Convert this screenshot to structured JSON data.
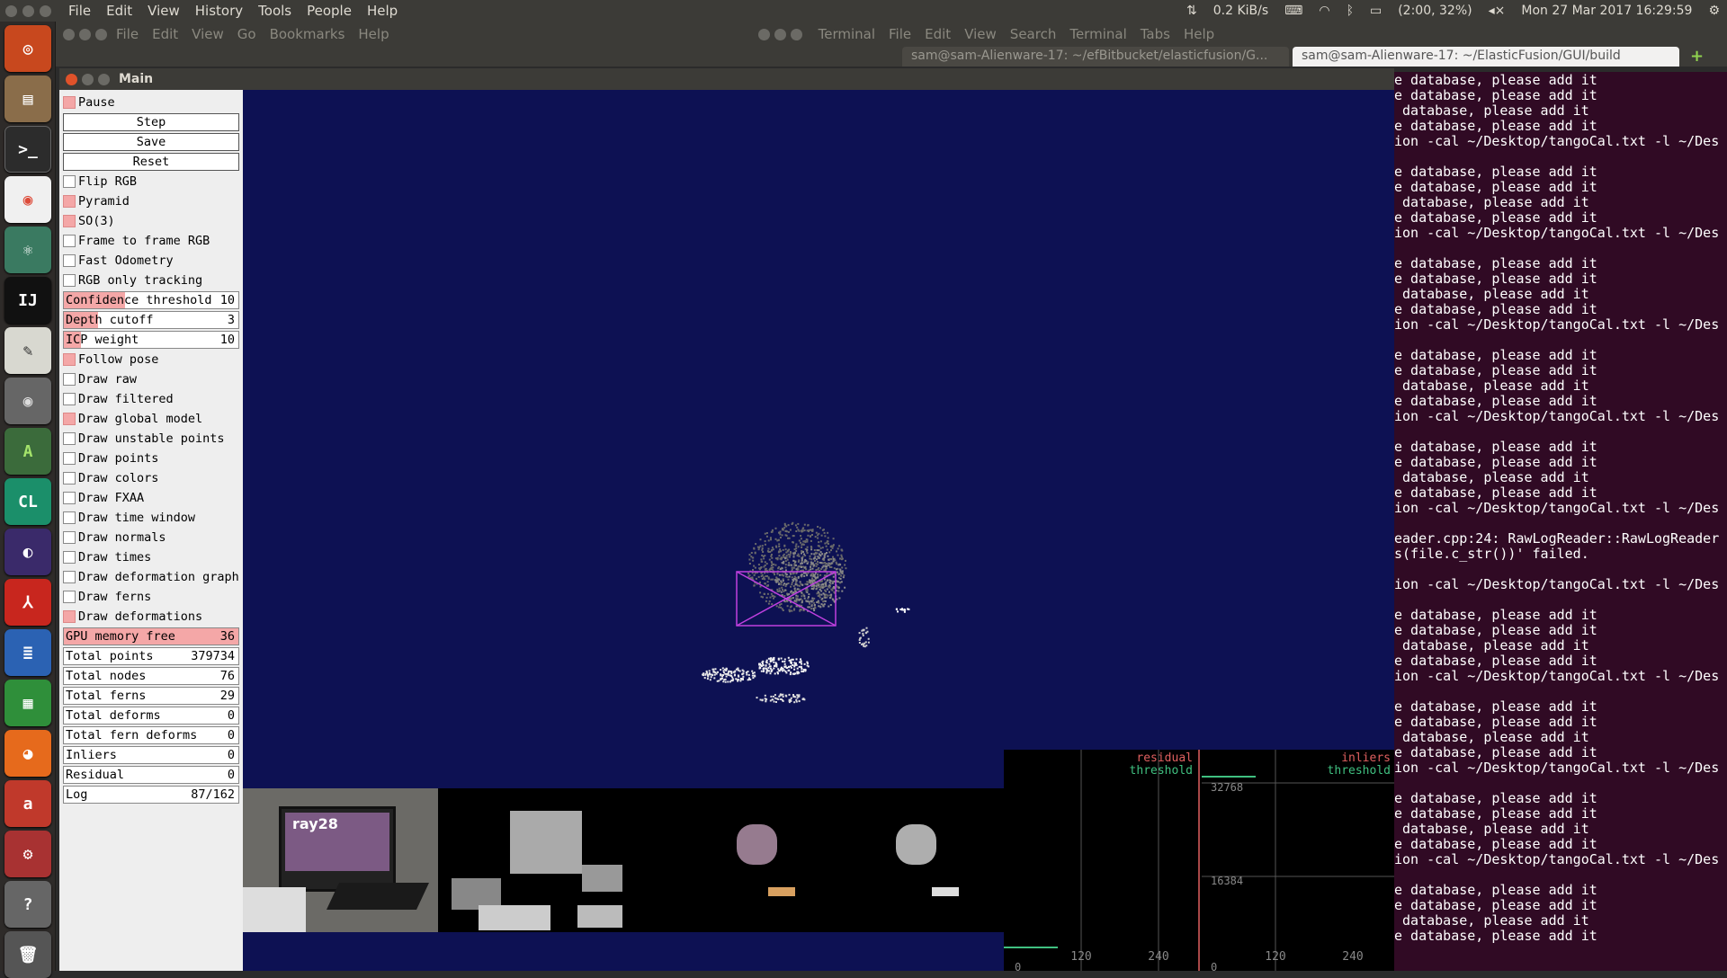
{
  "topbar": {
    "menu": [
      "File",
      "Edit",
      "View",
      "History",
      "Tools",
      "People",
      "Help"
    ],
    "net": "0.2 KiB/s",
    "battery": "(2:00, 32%)",
    "clock": "Mon 27 Mar 2017 16:29:59"
  },
  "bgwindow": {
    "menu": [
      "File",
      "Edit",
      "View",
      "Go",
      "Bookmarks",
      "Help"
    ],
    "terminal_menu": [
      "Terminal",
      "File",
      "Edit",
      "View",
      "Search",
      "Terminal",
      "Tabs",
      "Help"
    ],
    "tab1": "sam@sam-Alienware-17: ~/efBitbucket/elasticfusion/G...",
    "tab2": "sam@sam-Alienware-17: ~/ElasticFusion/GUI/build"
  },
  "launcher": [
    "ubuntu",
    "files",
    "terminal",
    "chrome",
    "atom",
    "intellij",
    "text-editor",
    "eye",
    "android-studio",
    "clion",
    "eclipse",
    "acrobat",
    "writer",
    "calc",
    "firefox",
    "amazon",
    "settings",
    "help",
    "trash"
  ],
  "main": {
    "title": "Main"
  },
  "panel": {
    "pause": "Pause",
    "step": "Step",
    "save": "Save",
    "reset": "Reset",
    "flip_rgb": "Flip RGB",
    "pyramid": "Pyramid",
    "so3": "SO(3)",
    "f2f": "Frame to frame RGB",
    "fast_odo": "Fast Odometry",
    "rgb_only": "RGB only tracking",
    "conf_label": "Confidence threshold",
    "conf_val": "10",
    "depth_label": "Depth cutoff",
    "depth_val": "3",
    "icp_label": "ICP weight",
    "icp_val": "10",
    "follow": "Follow pose",
    "draw_raw": "Draw raw",
    "draw_filtered": "Draw filtered",
    "draw_global": "Draw global model",
    "draw_unstable": "Draw unstable points",
    "draw_points": "Draw points",
    "draw_colors": "Draw colors",
    "draw_fxaa": "Draw FXAA",
    "draw_time": "Draw time window",
    "draw_normals": "Draw normals",
    "draw_times": "Draw times",
    "draw_deform_graph": "Draw deformation graph",
    "draw_ferns": "Draw ferns",
    "draw_deforms": "Draw deformations",
    "gpu_label": "GPU memory free",
    "gpu_val": "36",
    "tp_label": "Total points",
    "tp_val": "379734",
    "tn_label": "Total nodes",
    "tn_val": "76",
    "tf_label": "Total ferns",
    "tf_val": "29",
    "td_label": "Total deforms",
    "td_val": "0",
    "tfd_label": "Total fern deforms",
    "tfd_val": "0",
    "inl_label": "Inliers",
    "inl_val": "0",
    "res_label": "Residual",
    "res_val": "0",
    "log_label": "Log",
    "log_val": "87/162"
  },
  "thumb1_text": "ray28",
  "plots": {
    "res_title": "residual",
    "res_thr": "threshold",
    "inl_title": "inliers",
    "inl_thr": "threshold",
    "y1": "32768",
    "y2": "16384",
    "x": [
      "120",
      "240",
      "120",
      "240"
    ],
    "zero": "0"
  },
  "terminal_lines": [
    "e database, please add it",
    "e database, please add it",
    " database, please add it",
    "e database, please add it",
    "ion -cal ~/Desktop/tangoCal.txt -l ~/Des",
    "",
    "e database, please add it",
    "e database, please add it",
    " database, please add it",
    "e database, please add it",
    "ion -cal ~/Desktop/tangoCal.txt -l ~/Des",
    "",
    "e database, please add it",
    "e database, please add it",
    " database, please add it",
    "e database, please add it",
    "ion -cal ~/Desktop/tangoCal.txt -l ~/Des",
    "",
    "e database, please add it",
    "e database, please add it",
    " database, please add it",
    "e database, please add it",
    "ion -cal ~/Desktop/tangoCal.txt -l ~/Des",
    "",
    "e database, please add it",
    "e database, please add it",
    " database, please add it",
    "e database, please add it",
    "ion -cal ~/Desktop/tangoCal.txt -l ~/Des",
    "",
    "eader.cpp:24: RawLogReader::RawLogReader",
    "s(file.c_str())' failed.",
    "",
    "ion -cal ~/Desktop/tangoCal.txt -l ~/Des",
    "",
    "e database, please add it",
    "e database, please add it",
    " database, please add it",
    "e database, please add it",
    "ion -cal ~/Desktop/tangoCal.txt -l ~/Des",
    "",
    "e database, please add it",
    "e database, please add it",
    " database, please add it",
    "e database, please add it",
    "ion -cal ~/Desktop/tangoCal.txt -l ~/Des",
    "",
    "e database, please add it",
    "e database, please add it",
    " database, please add it",
    "e database, please add it",
    "ion -cal ~/Desktop/tangoCal.txt -l ~/Des",
    "",
    "e database, please add it",
    "e database, please add it",
    " database, please add it",
    "e database, please add it"
  ]
}
